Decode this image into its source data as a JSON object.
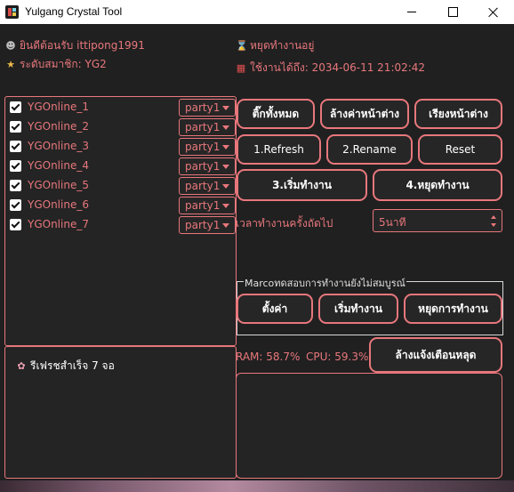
{
  "window": {
    "title": "Yulgang Crystal Tool",
    "controls": [
      "minimize",
      "maximize",
      "close"
    ]
  },
  "user": {
    "welcome": "ยินดีต้อนรับ ittipong1991",
    "membership": "ระดับสมาชิก: YG2",
    "welcome_icon": "user-icon",
    "membership_icon": "medal-icon"
  },
  "status": {
    "state": "หยุดทำงานอยู่",
    "expiry": "ใช้งานได้ถึง: 2034-06-11 21:02:42",
    "state_icon": "hourglass-icon",
    "expiry_icon": "calendar-icon"
  },
  "accounts": [
    {
      "name": "YGOnline_1",
      "checked": true,
      "party": "party1"
    },
    {
      "name": "YGOnline_2",
      "checked": true,
      "party": "party1"
    },
    {
      "name": "YGOnline_3",
      "checked": true,
      "party": "party1"
    },
    {
      "name": "YGOnline_4",
      "checked": true,
      "party": "party1"
    },
    {
      "name": "YGOnline_5",
      "checked": true,
      "party": "party1"
    },
    {
      "name": "YGOnline_6",
      "checked": true,
      "party": "party1"
    },
    {
      "name": "YGOnline_7",
      "checked": true,
      "party": "party1"
    }
  ],
  "log": {
    "icon": "brain-icon",
    "message": "รีเฟรชสำเร็จ 7 จอ"
  },
  "buttons": {
    "check_all": "ติ๊กทั้งหมด",
    "clear_windows": "ล้างค่าหน้าต่าง",
    "arrange_windows": "เรียงหน้าต่าง",
    "refresh": "1.Refresh",
    "rename": "2.Rename",
    "reset": "Reset",
    "start": "3.เริ่มทำงาน",
    "stop": "4.หยุดทำงาน",
    "macro_settings": "ตั้งค่า",
    "macro_start": "เริ่มทำงาน",
    "macro_stop": "หยุดการทำงาน",
    "clear_alerts": "ล้างแจ้งเตือนหลุด"
  },
  "next_run": {
    "label": "เวลาทำงานครั้งถัดไป",
    "value": "5นาที"
  },
  "macro_group": {
    "title": "Marcoทดสอบการทำงานยังไม่สมบูรณ์"
  },
  "system": {
    "ram": "RAM: 58.7%",
    "cpu": "CPU: 59.3%"
  },
  "colors": {
    "accent": "#e8777c",
    "background": "#202020",
    "button_text": "#ffffff"
  }
}
